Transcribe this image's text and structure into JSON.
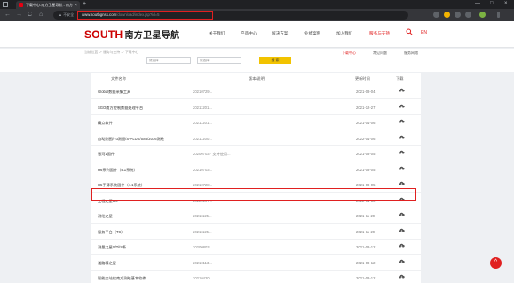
{
  "browser": {
    "tab_title": "下载中心-南方卫星导航 - 南方...",
    "tab_close": "×",
    "new_tab": "+",
    "back": "←",
    "forward": "→",
    "reload": "C",
    "home": "⌂",
    "secure_label": "▲ 不安全",
    "url_host": "www.southgnss.com",
    "url_path": "/download/index.jsp?id=5",
    "window_controls": [
      "—",
      "□",
      "×"
    ]
  },
  "header": {
    "logo_text": "SOUTH",
    "logo_cn": "南方卫星导航",
    "nav": [
      "关于我们",
      "产品中心",
      "解决方案",
      "业绩案例",
      "加入我们",
      "服务与支持"
    ],
    "search_icon": "search-icon",
    "lang": "EN"
  },
  "strip": {
    "breadcrumb": "当前位置 ＞ 服务与支持 ＞ 下载中心",
    "filter1": "请选择",
    "filter2": "请选择",
    "search_label": "搜 索",
    "subtabs": [
      "下载中心",
      "常见问题",
      "服务网络"
    ],
    "active_subtab": "下载中心"
  },
  "table": {
    "headers": [
      "文件名称",
      "版本/说明",
      "更新时间",
      "下载"
    ],
    "rows": [
      {
        "name": "Global数据采集工具",
        "version": "20210729...",
        "date": "2021-08-04"
      },
      {
        "name": "SGO南方控制数据处理平台",
        "version": "20211201...",
        "date": "2021-12-27"
      },
      {
        "name": "精点软件",
        "version": "20211201...",
        "date": "2021-01-06"
      },
      {
        "name": "自动测图/Yu测图/S-PLUS/S86/2016测绘",
        "version": "20211200...",
        "date": "2022-01-06"
      },
      {
        "name": "银河1固件",
        "version": "20200703 · 支持使用...",
        "date": "2021-08-05"
      },
      {
        "name": "H6系列固件（4.1系统）",
        "version": "20210703...",
        "date": "2021-08-05"
      },
      {
        "name": "H5手薄系统固件（4.1系统）",
        "version": "20210728...",
        "date": "2021-08-05"
      },
      {
        "name": "工程之星5.0",
        "version": "20220107...",
        "date": "2022-01-10"
      },
      {
        "name": "测绘之星",
        "version": "20211125...",
        "date": "2021-11-29"
      },
      {
        "name": "服务平台（TS）",
        "version": "20211125...",
        "date": "2021-11-29"
      },
      {
        "name": "测量之星S/Ti/S系",
        "version": "20200803...",
        "date": "2021-08-12"
      },
      {
        "name": "道路精之星",
        "version": "20210113...",
        "date": "2021-08-12"
      },
      {
        "name": "智能全站仪南方测绘基本软件",
        "version": "20210420...",
        "date": "2021-08-12"
      }
    ],
    "highlight_row_name": "工程之星5.0",
    "download_icon": "cloud-download-icon"
  },
  "float_button": "^",
  "colors": {
    "brand_red": "#cc0000",
    "accent_red": "#e02020",
    "search_yellow": "#f2c300"
  }
}
